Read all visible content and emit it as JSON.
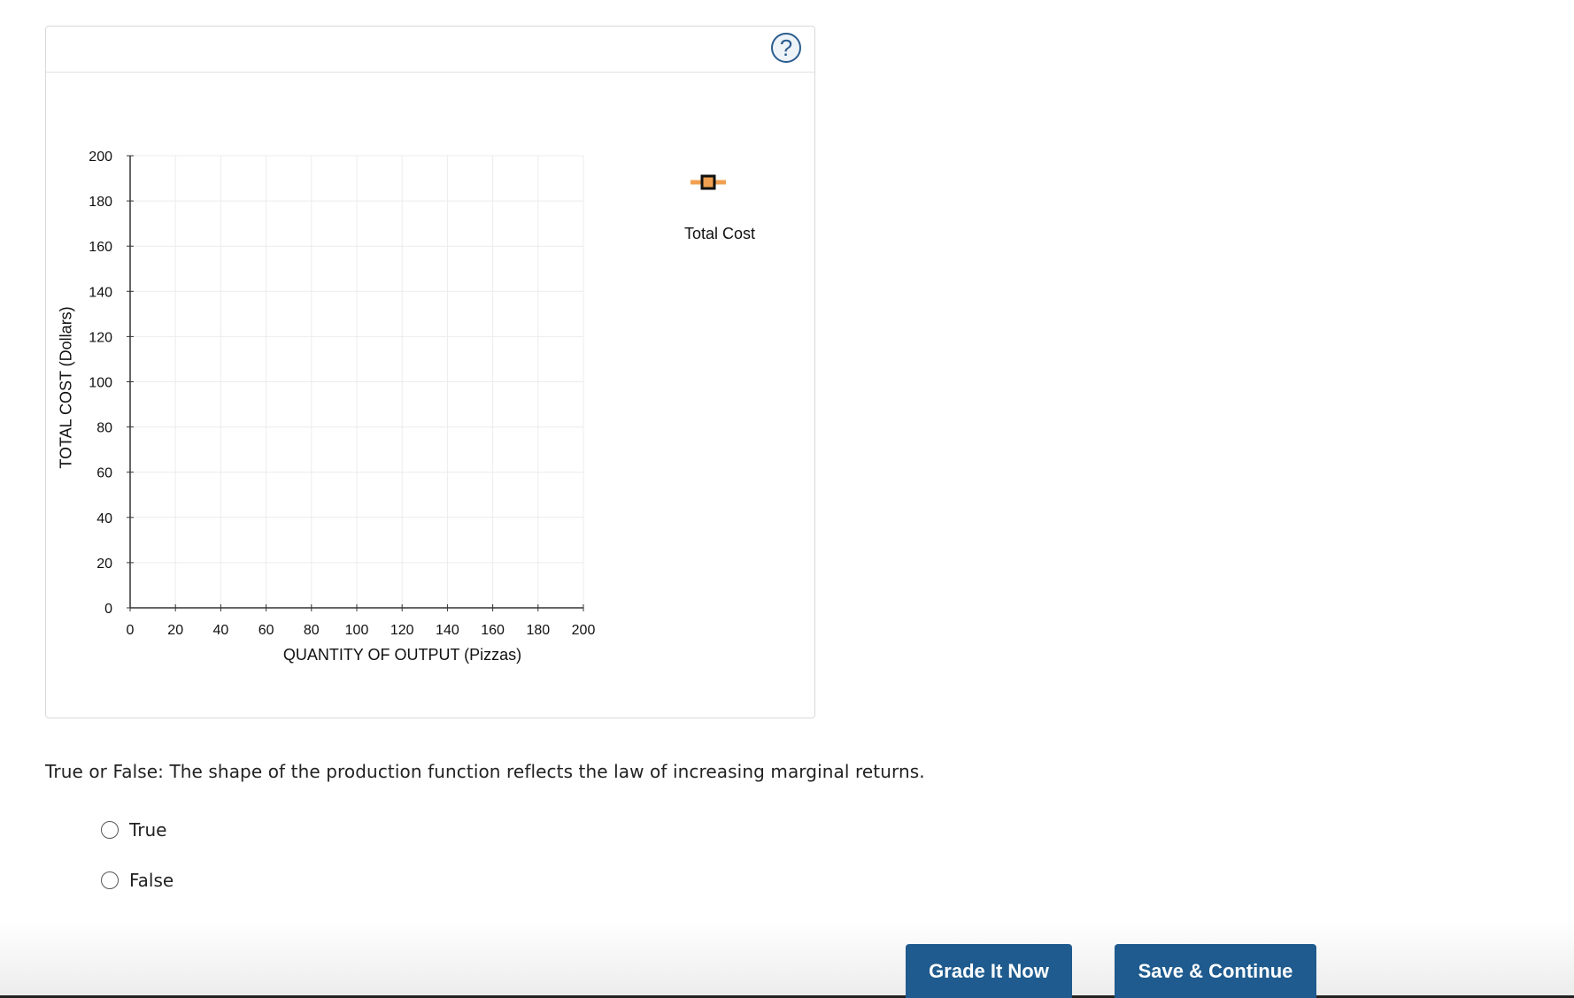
{
  "graph": {
    "help_label": "?",
    "legend": {
      "label": "Total Cost",
      "marker_color": "#f0a050",
      "icon": "square-marker-icon"
    },
    "chart_data": {
      "type": "line",
      "title": "",
      "xlabel": "QUANTITY OF OUTPUT (Pizzas)",
      "ylabel": "TOTAL COST (Dollars)",
      "xlim": [
        0,
        200
      ],
      "ylim": [
        0,
        200
      ],
      "x_ticks": [
        "0",
        "20",
        "40",
        "60",
        "80",
        "100",
        "120",
        "140",
        "160",
        "180",
        "200"
      ],
      "y_ticks": [
        "0",
        "20",
        "40",
        "60",
        "80",
        "100",
        "120",
        "140",
        "160",
        "180",
        "200"
      ],
      "grid": true,
      "series": [
        {
          "name": "Total Cost",
          "points": []
        }
      ]
    }
  },
  "question": {
    "text": "True or False: The shape of the production function reflects the law of increasing marginal returns.",
    "options": [
      {
        "label": "True"
      },
      {
        "label": "False"
      }
    ]
  },
  "actions": {
    "grade_label": "Grade It Now",
    "save_label": "Save & Continue",
    "button_color": "#1f5b8e"
  }
}
